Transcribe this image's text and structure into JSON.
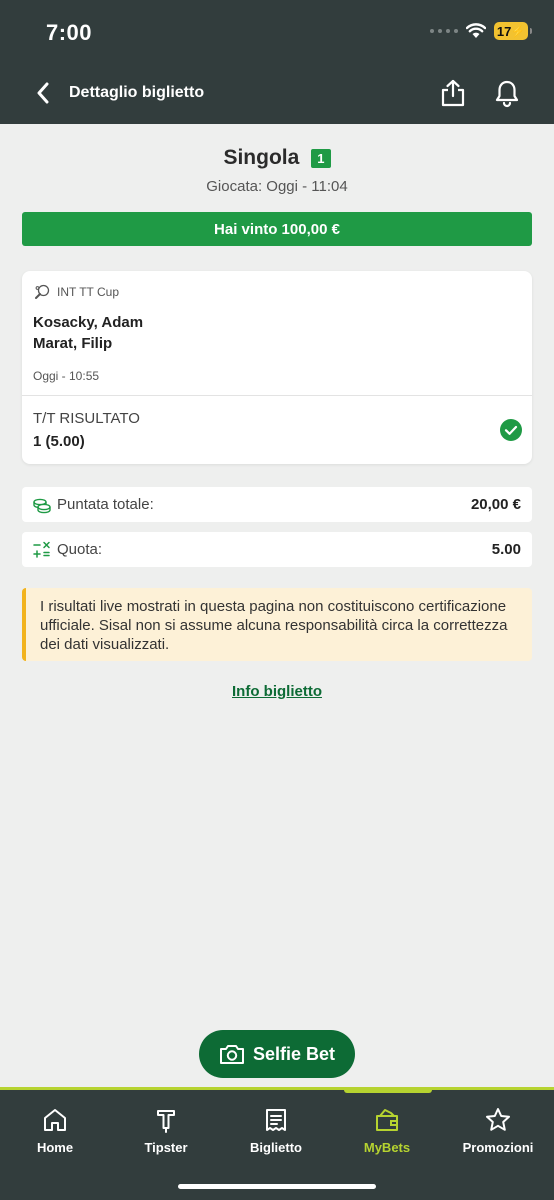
{
  "status": {
    "time": "7:00",
    "battery": "17"
  },
  "header": {
    "title": "Dettaglio biglietto"
  },
  "ticket": {
    "type": "Singola",
    "count": "1",
    "played": "Giocata: Oggi - 11:04",
    "win": "Hai vinto 100,00 €"
  },
  "event": {
    "competition": "INT TT Cup",
    "team1": "Kosacky, Adam",
    "team2": "Marat, Filip",
    "time": "Oggi - 10:55",
    "market": "T/T RISULTATO",
    "selection": "1 (5.00)"
  },
  "summary": {
    "stake_label": "Puntata totale:",
    "stake_value": "20,00 €",
    "odds_label": "Quota:",
    "odds_value": "5.00"
  },
  "disclaimer": "I risultati live mostrati in questa pagina non costituiscono certificazione ufficiale. Sisal non si assume alcuna responsabilità circa la correttezza dei dati visualizzati.",
  "info_link": "Info biglietto",
  "selfie_label": "Selfie Bet",
  "tabs": [
    {
      "label": "Home"
    },
    {
      "label": "Tipster"
    },
    {
      "label": "Biglietto"
    },
    {
      "label": "MyBets"
    },
    {
      "label": "Promozioni"
    }
  ],
  "colors": {
    "header": "#323d3d",
    "green": "#1f9a45",
    "dark_green": "#0d6b35",
    "accent": "#b6d330",
    "warning": "#f2b31d"
  }
}
